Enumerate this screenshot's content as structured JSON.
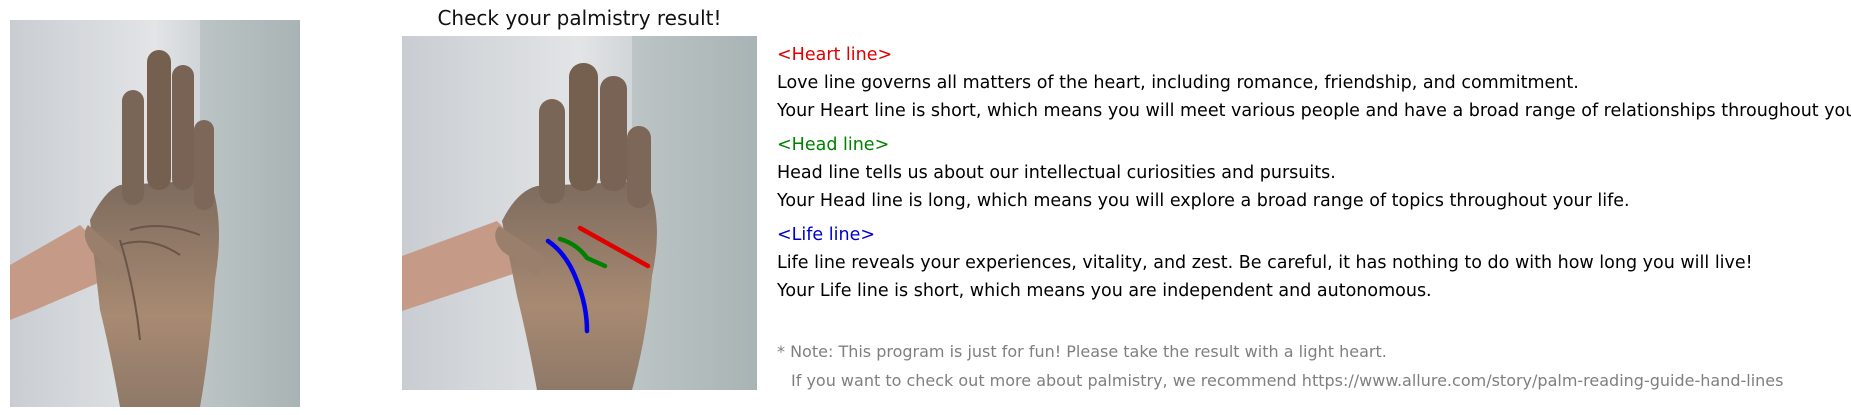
{
  "title": "Check your palmistry result!",
  "sections": [
    {
      "heading": "<Heart line>",
      "color": "#e00000",
      "lines": [
        "Love line governs all matters of the heart, including romance, friendship, and commitment.",
        "Your Heart line is short, which means you will meet various people and have a broad range of relationships throughout your life."
      ]
    },
    {
      "heading": "<Head line>",
      "color": "#008000",
      "lines": [
        "Head line tells us about our intellectual curiosities and pursuits.",
        "Your Head line is long, which means you will explore a broad range of topics throughout your life."
      ]
    },
    {
      "heading": "<Life line>",
      "color": "#0000cc",
      "lines": [
        "Life line reveals your experiences, vitality, and zest. Be careful, it has nothing to do with how long you will live!",
        "Your Life line is short, which means you are independent and autonomous."
      ]
    }
  ],
  "note": {
    "line1": "* Note: This program is just for fun! Please take the result with a light heart.",
    "line2": "If you want to check out more about palmistry, we recommend https://www.allure.com/story/palm-reading-guide-hand-lines"
  },
  "colors": {
    "heart": "#e00000",
    "head": "#008000",
    "life": "#0000ee",
    "note_text": "#7f7f7f"
  }
}
